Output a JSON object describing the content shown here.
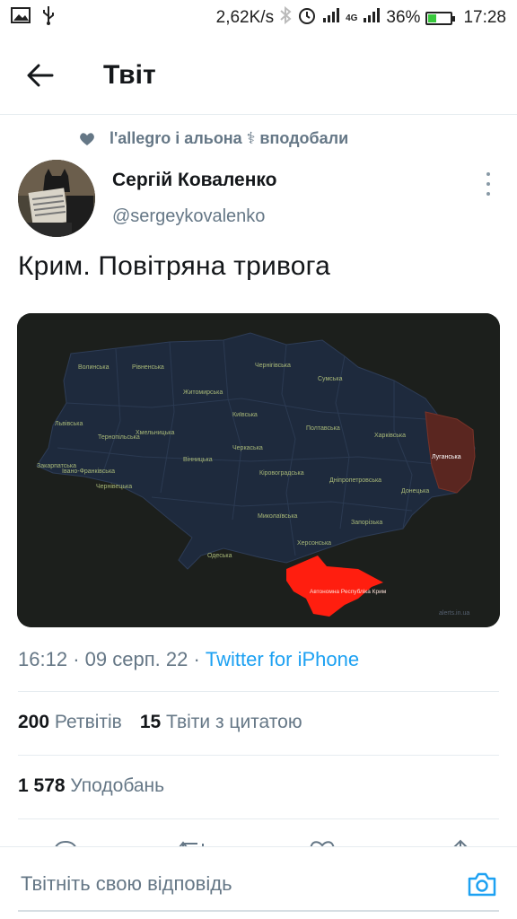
{
  "status_bar": {
    "network_speed": "2,62K/s",
    "signal_label": "4G",
    "battery_percent": "36%",
    "time": "17:28",
    "battery_level": 0.36
  },
  "header": {
    "title": "Твіт"
  },
  "social_context": {
    "text": "l'allegro і альона ⚕ вподобали"
  },
  "author": {
    "name": "Сергій Коваленко",
    "handle": "@sergeykovalenko"
  },
  "tweet": {
    "text": "Крим. Повітряна тривога",
    "time": "16:12",
    "date": "09 серп. 22",
    "source": "Twitter for iPhone",
    "separator": "·"
  },
  "map": {
    "highlight_label": "Автономна Республіка Крим",
    "luhansk_label": "Луганська",
    "watermark": "alerts.in.ua",
    "labels": {
      "volynska": "Волинська",
      "rivnenska": "Рівненська",
      "zhytomyrska": "Житомирська",
      "kyivska": "Київська",
      "chernihivska": "Чернігівська",
      "sumska": "Сумська",
      "poltavska": "Полтавська",
      "kharkivska": "Харківська",
      "lvivska": "Львівська",
      "ternopilska": "Тернопільська",
      "khmelnytska": "Хмельницька",
      "vinnytska": "Вінницька",
      "cherkaska": "Черкаська",
      "kirovohradska": "Кіровоградська",
      "dnipropetrovska": "Дніпропетровська",
      "donetska": "Донецька",
      "zakarpatska": "Закарпатська",
      "ivano_frankivska": "Івано-Франківська",
      "chernivetska": "Чернівецька",
      "mykolaivska": "Миколаївська",
      "zaporizka": "Запорізька",
      "khersonska": "Херсонська",
      "odeska": "Одеська"
    },
    "colors": {
      "background": "#1c1f1c",
      "land": "#1e2a3d",
      "alert": "#ff1e0f",
      "occupied": "#5a2620",
      "label_text": "#a8b878"
    }
  },
  "stats": {
    "retweets_count": "200",
    "retweets_label": "Ретвітів",
    "quotes_count": "15",
    "quotes_label": "Твіти з цитатою",
    "likes_count": "1 578",
    "likes_label": "Уподобань"
  },
  "reply": {
    "placeholder": "Твітніть свою відповідь"
  },
  "colors": {
    "accent": "#1da1f2",
    "secondary_text": "#657786",
    "primary_text": "#14171a"
  },
  "icons": {
    "back": "arrow-left-icon",
    "like": "heart-icon",
    "more": "more-vertical-icon",
    "camera": "camera-icon"
  }
}
